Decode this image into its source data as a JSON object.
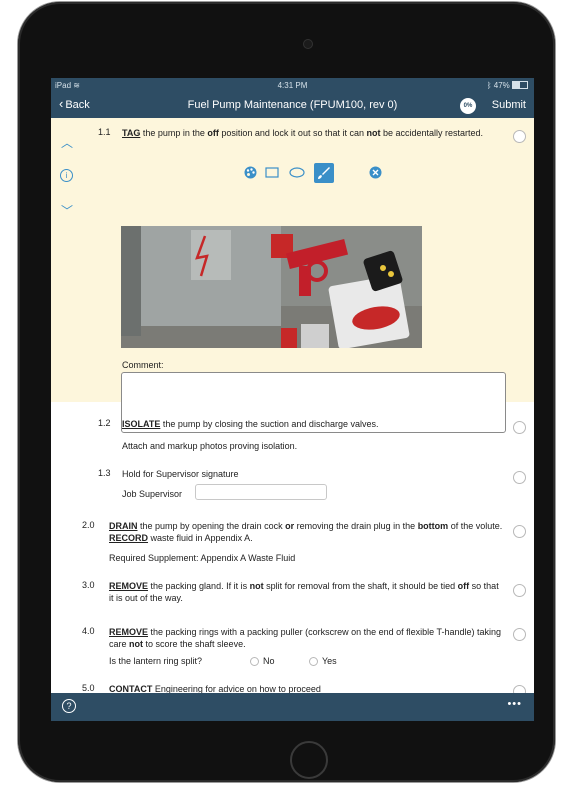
{
  "status": {
    "device": "iPad",
    "time": "4:31 PM",
    "battery": "47%"
  },
  "nav": {
    "back_label": "Back",
    "title": "Fuel Pump Maintenance (FPUM100, rev 0)",
    "progress": "0%",
    "submit_label": "Submit"
  },
  "steps": {
    "s1_1": {
      "num": "1.1",
      "verb": "TAG",
      "t1": " the pump in the ",
      "b1": "off",
      "t2": " position and lock it out so that it can ",
      "b2": "not",
      "t3": " be accidentally restarted."
    },
    "comment_label": "Comment:",
    "s1_2": {
      "num": "1.2",
      "verb": "ISOLATE",
      "text": " the pump by closing the suction and discharge valves.",
      "note": "Attach and markup photos proving isolation."
    },
    "s1_3": {
      "num": "1.3",
      "text": "Hold for Supervisor signature",
      "field_label": "Job Supervisor"
    },
    "s2_0": {
      "num": "2.0",
      "verb": "DRAIN",
      "t1": " the pump by opening the drain cock ",
      "b1": "or",
      "t2": " removing the drain plug in the ",
      "b2": "bottom",
      "t3": " of the volute. ",
      "verb2": "RECORD",
      "t4": " waste fluid in Appendix A.",
      "supplement": "Required Supplement:  Appendix A Waste Fluid"
    },
    "s3_0": {
      "num": "3.0",
      "verb": "REMOVE",
      "t1": " the packing gland. If it is ",
      "b1": "not",
      "t2": " split for removal from the shaft, it should be tied ",
      "b2": "off",
      "t3": " so that it is out of the way."
    },
    "s4_0": {
      "num": "4.0",
      "verb": "REMOVE",
      "t1": " the packing rings with a packing puller (corkscrew on the end of flexible T-handle) taking care ",
      "b1": "not",
      "t2": " to score the shaft sleeve.",
      "question": "Is the lantern ring split?",
      "opt_no": "No",
      "opt_yes": "Yes"
    },
    "s5_0": {
      "num": "5.0",
      "verb": "CONTACT",
      "text": " Engineering for advice on how to proceed"
    }
  },
  "icons": {
    "collapse": "chevron-up-icon",
    "info": "info-icon",
    "expand": "chevron-down-icon",
    "palette": "palette-icon",
    "rectangle": "rectangle-tool-icon",
    "ellipse": "ellipse-tool-icon",
    "brush": "brush-tool-icon",
    "close": "close-circle-icon",
    "help": "help-icon",
    "more": "more-icon"
  },
  "colors": {
    "nav": "#2e4d64",
    "active_bg": "#fdf6dc",
    "accent": "#3a8fc8"
  }
}
